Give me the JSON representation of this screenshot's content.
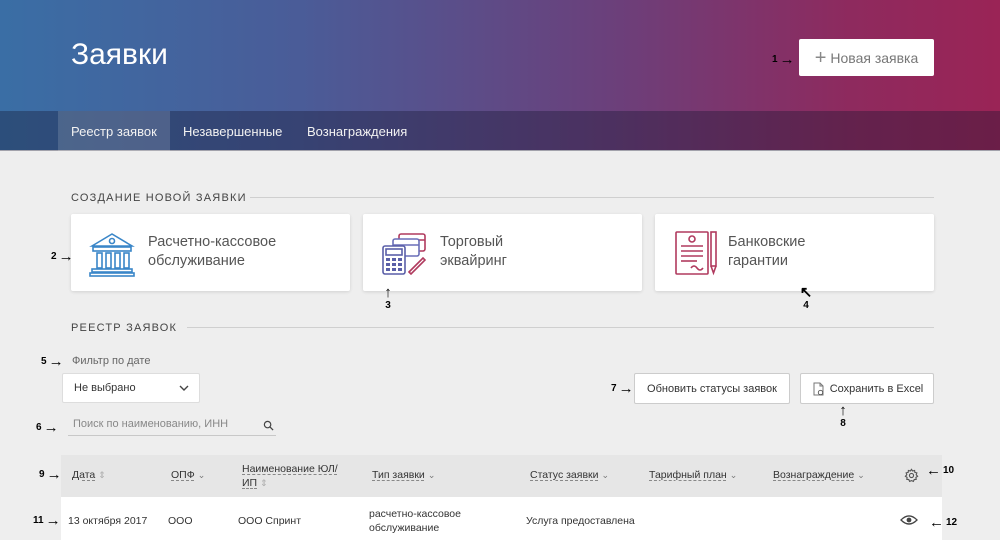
{
  "header": {
    "title": "Заявки",
    "new_request_plus": "+",
    "new_request_label": "Новая заявка"
  },
  "tabs": [
    {
      "label": "Реестр заявок",
      "active": true
    },
    {
      "label": "Незавершенные",
      "active": false
    },
    {
      "label": "Вознаграждения",
      "active": false
    }
  ],
  "create_section": {
    "title": "СОЗДАНИЕ НОВОЙ ЗАЯВКИ",
    "cards": [
      {
        "line1": "Расчетно-кассовое",
        "line2": "обслуживание",
        "icon": "bank-icon",
        "color": "#3a86c8"
      },
      {
        "line1": "Торговый",
        "line2": "эквайринг",
        "icon": "pos-terminal-icon",
        "color": "#5a5fa8"
      },
      {
        "line1": "Банковские",
        "line2": "гарантии",
        "icon": "guarantee-document-icon",
        "color": "#b03a5e"
      }
    ]
  },
  "registry": {
    "title": "РЕЕСТР ЗАЯВОК",
    "filter_label": "Фильтр по дате",
    "filter_value": "Не выбрано",
    "refresh_button": "Обновить статусы заявок",
    "excel_button": "Сохранить в Excel",
    "search_placeholder": "Поиск по наименованию, ИНН"
  },
  "table": {
    "columns": {
      "date": "Дата",
      "opf": "ОПФ",
      "name_line1": "Наименование ЮЛ/",
      "name_line2": "ИП",
      "type": "Тип заявки",
      "status": "Статус заявки",
      "plan": "Тарифный план",
      "reward": "Вознаграждение"
    },
    "rows": [
      {
        "date": "13 октября 2017",
        "opf": "ООО",
        "name": "ООО Спринт",
        "type_line1": "расчетно-кассовое",
        "type_line2": "обслуживание",
        "status": "Услуга предоставлена",
        "plan": "",
        "reward": ""
      }
    ]
  },
  "annotations": {
    "a1": "1",
    "a2": "2",
    "a3": "3",
    "a4": "4",
    "a5": "5",
    "a6": "6",
    "a7": "7",
    "a8": "8",
    "a9": "9",
    "a10": "10",
    "a11": "11",
    "a12": "12"
  },
  "colors": {
    "header_gradient_start": "#3a6ea5",
    "header_gradient_end": "#9a2456"
  }
}
